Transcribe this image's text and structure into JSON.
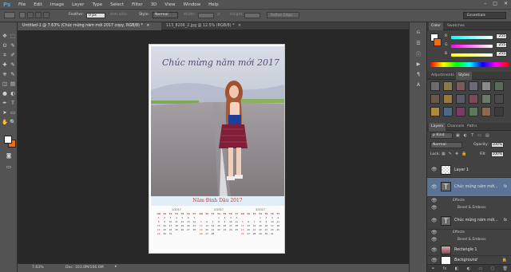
{
  "app": {
    "logo": "Ps"
  },
  "menu": [
    "File",
    "Edit",
    "Image",
    "Layer",
    "Type",
    "Select",
    "Filter",
    "3D",
    "View",
    "Window",
    "Help"
  ],
  "window_controls": [
    "–",
    "□",
    "✕"
  ],
  "options": {
    "feather_label": "Feather:",
    "feather_value": "0 px",
    "antialias_label": "Anti-alias",
    "style_label": "Style:",
    "style_value": "Normal",
    "width_label": "Width:",
    "height_label": "Height:",
    "refine_label": "Refine Edge...",
    "workspace": "Essentials"
  },
  "tabs": [
    {
      "label": "Untitled-1 @ 7.63% (Chúc mừng năm mới 2017 copy, RGB/8) *",
      "close": "×"
    },
    {
      "label": "113_8206_2.jpg @ 12.5% (RGB/8) *",
      "close": "×"
    }
  ],
  "tools": [
    "move-icon",
    "marquee-icon",
    "lasso-icon",
    "quick-select-icon",
    "crop-icon",
    "eyedropper-icon",
    "spot-heal-icon",
    "brush-icon",
    "clone-stamp-icon",
    "history-brush-icon",
    "eraser-icon",
    "gradient-icon",
    "blur-icon",
    "dodge-icon",
    "pen-icon",
    "type-icon",
    "path-select-icon",
    "shape-icon",
    "hand-icon",
    "zoom-icon"
  ],
  "tool_glyphs": [
    "✥",
    "⬚",
    "ʘ",
    "✎",
    "⌗",
    "✐",
    "✚",
    "✎",
    "⎈",
    "✎",
    "◫",
    "▤",
    "●",
    "◐",
    "✒",
    "T",
    "➤",
    "▭",
    "✋",
    "🔍"
  ],
  "colors": {
    "foreground": "#ffffff",
    "background": "#ef6c12",
    "accent": "#4aa6e8"
  },
  "document": {
    "title_script": "Chúc mừng năm mới 2017",
    "year_title": "Năm Đinh Dậu 2017",
    "calendars": [
      {
        "month": "1/2017",
        "days_header": [
          "CN",
          "T2",
          "T3",
          "T4",
          "T5",
          "T6",
          "T7"
        ]
      },
      {
        "month": "2/2017",
        "days_header": [
          "CN",
          "T2",
          "T3",
          "T4",
          "T5",
          "T6",
          "T7"
        ]
      },
      {
        "month": "3/2017",
        "days_header": [
          "CN",
          "T2",
          "T3",
          "T4",
          "T5",
          "T6",
          "T7"
        ]
      }
    ]
  },
  "status": {
    "zoom": "7.63%",
    "doc": "Doc: 103.0M/166.6M"
  },
  "color_panel": {
    "tabs": [
      "Color",
      "Swatches"
    ],
    "channels": [
      {
        "label": "R",
        "value": "255"
      },
      {
        "label": "G",
        "value": "255"
      },
      {
        "label": "B",
        "value": "255"
      }
    ]
  },
  "adjust_panel": {
    "tabs": [
      "Adjustments",
      "Styles"
    ]
  },
  "layers_panel": {
    "tabs": [
      "Layers",
      "Channels",
      "Paths"
    ],
    "kind_label": "ρ Kind",
    "blend_mode": "Normal",
    "opacity_label": "Opacity:",
    "opacity_value": "100%",
    "lock_label": "Lock:",
    "fill_label": "Fill:",
    "fill_value": "100%",
    "layers": [
      {
        "name": "Layer 1",
        "type": "pixel",
        "selected": false
      },
      {
        "name": "Chúc mừng năm mới... ",
        "type": "text",
        "selected": true,
        "fx": "fx",
        "effects_label": "Effects",
        "effect": "Bevel & Emboss"
      },
      {
        "name": "Chúc mừng năm mới... ",
        "type": "text",
        "selected": false,
        "fx": "fx",
        "effects_label": "Effects",
        "effect": "Bevel & Emboss"
      },
      {
        "name": "Rectangle 1",
        "type": "shape",
        "selected": false
      },
      {
        "name": "Background",
        "type": "background",
        "selected": false
      }
    ],
    "bottom_icons": [
      "link-icon",
      "fx-icon",
      "mask-icon",
      "adjustment-icon",
      "folder-icon",
      "new-layer-icon",
      "trash-icon"
    ],
    "bottom_glyphs": [
      "⚭",
      "fx",
      "◧",
      "◐",
      "▭",
      "▢",
      "🗑"
    ]
  },
  "dock_icons": [
    "history-icon",
    "properties-icon",
    "info-icon",
    "actions-icon",
    "paragraph-icon",
    "character-icon"
  ],
  "dock_glyphs": [
    "⎌",
    "☰",
    "ⓘ",
    "▶",
    "¶",
    "A"
  ]
}
